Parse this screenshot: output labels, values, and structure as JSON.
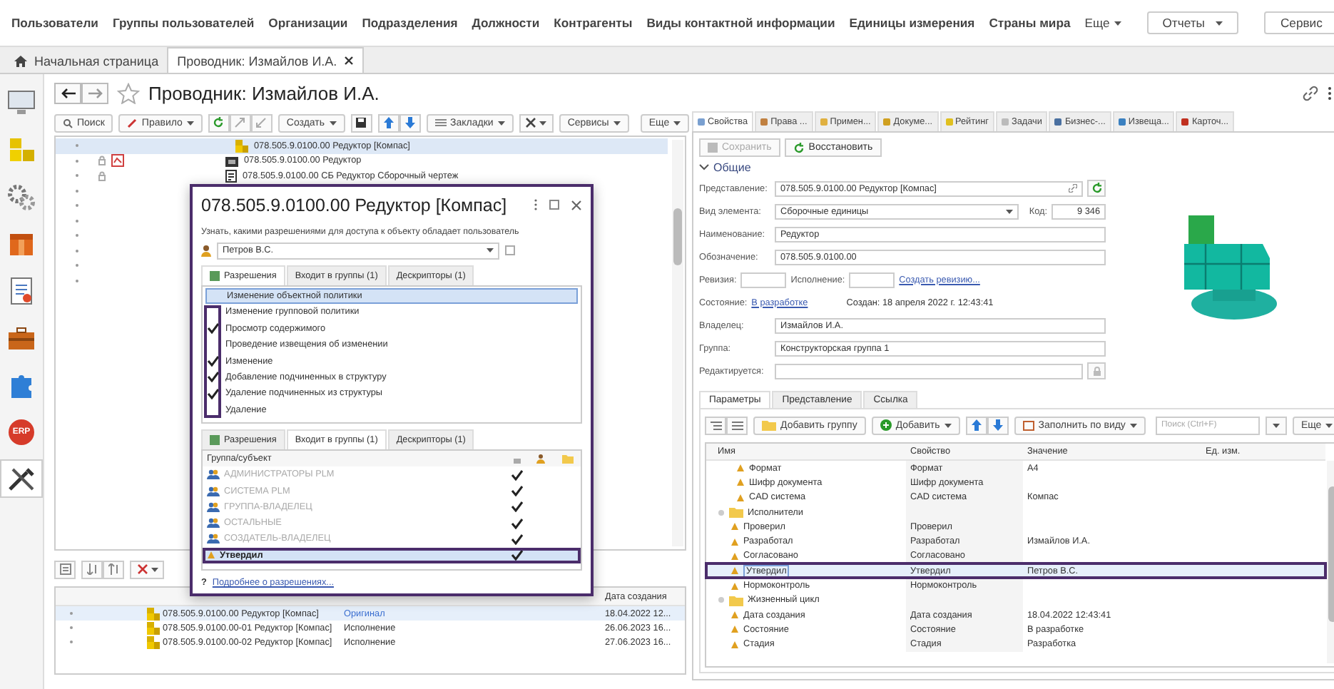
{
  "menu": {
    "items": [
      "Пользователи",
      "Группы пользователей",
      "Организации",
      "Подразделения",
      "Должности",
      "Контрагенты",
      "Виды контактной информации",
      "Единицы измерения",
      "Страны мира"
    ],
    "more": "Еще",
    "buttons": [
      "Отчеты",
      "Сервис"
    ]
  },
  "tabs": [
    {
      "label": "Начальная страница",
      "selected": false,
      "kind": "home"
    },
    {
      "label": "Проводник: Измайлов И.А.",
      "selected": true,
      "kind": "page"
    }
  ],
  "sidebar": [
    {
      "kind": "monitor",
      "selected": false
    },
    {
      "kind": "blocks",
      "selected": false
    },
    {
      "kind": "gears",
      "selected": false
    },
    {
      "kind": "box",
      "selected": false
    },
    {
      "kind": "document",
      "selected": false
    },
    {
      "kind": "briefcase",
      "selected": false
    },
    {
      "kind": "puzzle",
      "selected": false
    },
    {
      "kind": "badge",
      "label": "ERP",
      "selected": false
    },
    {
      "kind": "tools",
      "selected": true
    }
  ],
  "page": {
    "title": "Проводник: Измайлов И.А."
  },
  "left_toolbar": {
    "buttons": [
      {
        "label": "Поиск",
        "dropdown": false
      },
      {
        "label": "Правило",
        "dropdown": true
      },
      {
        "label": "Создать",
        "dropdown": true
      },
      {
        "label": "Закладки",
        "dropdown": true
      },
      {
        "label": "Сервисы",
        "dropdown": true
      },
      {
        "label": "Еще",
        "dropdown": true
      }
    ]
  },
  "tree": {
    "rows": [
      {
        "text": "078.505.9.0100.00 Редуктор [Компас]",
        "kind": "assembly",
        "selected": true,
        "children": [
          {
            "text": "078.505.9.0100.00 Редуктор",
            "kind": "model",
            "selected": false
          },
          {
            "text": "078.505.9.0100.00 СБ Редуктор Сборочный чертеж",
            "kind": "drawing",
            "selected": false
          }
        ]
      }
    ]
  },
  "versions": {
    "columns": [
      "Дата создания"
    ],
    "rows": [
      {
        "name": "078.505.9.0100.00 Редуктор [Компас]",
        "decision": "Оригинал",
        "date": "18.04.2022 12...",
        "selected": true
      },
      {
        "name": "078.505.9.0100.00-01 Редуктор [Компас]",
        "decision": "Исполнение",
        "date": "26.06.2023 16...",
        "selected": false
      },
      {
        "name": "078.505.9.0100.00-02 Редуктор [Компас]",
        "decision": "Исполнение",
        "date": "27.06.2023 16...",
        "selected": false
      }
    ]
  },
  "dialog": {
    "title": "078.505.9.0100.00 Редуктор [Компас]",
    "hint": "Узнать, какими разрешениями для доступа к объекту обладает пользователь",
    "user": "Петров В.С.",
    "tabs_top": [
      {
        "label": "Разрешения",
        "selected": true
      },
      {
        "label": "Входит в группы (1)",
        "selected": false
      },
      {
        "label": "Дескрипторы (1)",
        "selected": false
      }
    ],
    "permissions": [
      {
        "label": "Изменение объектной политики",
        "checked": false,
        "selected": true
      },
      {
        "label": "Изменение групповой политики",
        "checked": false,
        "selected": false
      },
      {
        "label": "Просмотр содержимого",
        "checked": true,
        "selected": false
      },
      {
        "label": "Проведение извещения об изменении",
        "checked": false,
        "selected": false
      },
      {
        "label": "Изменение",
        "checked": true,
        "selected": false
      },
      {
        "label": "Добавление подчиненных в структуру",
        "checked": true,
        "selected": false
      },
      {
        "label": "Удаление подчиненных из структуры",
        "checked": true,
        "selected": false
      },
      {
        "label": "Удаление",
        "checked": false,
        "selected": false
      }
    ],
    "tabs_bottom": [
      {
        "label": "Разрешения",
        "selected": false
      },
      {
        "label": "Входит в группы (1)",
        "selected": true
      },
      {
        "label": "Дескрипторы (1)",
        "selected": false
      }
    ],
    "groups_columns": [
      "Группа/субъект"
    ],
    "groups": [
      {
        "name": "АДМИНИСТРАТОРЫ PLM",
        "kind": "group",
        "checked": true,
        "selected": false
      },
      {
        "name": "СИСТЕМА PLM",
        "kind": "group",
        "checked": true,
        "selected": false
      },
      {
        "name": "ГРУППА-ВЛАДЕЛЕЦ",
        "kind": "group",
        "checked": true,
        "selected": false
      },
      {
        "name": "ОСТАЛЬНЫЕ",
        "kind": "group",
        "checked": true,
        "selected": false
      },
      {
        "name": "СОЗДАТЕЛЬ-ВЛАДЕЛЕЦ",
        "kind": "group",
        "checked": true,
        "selected": false
      },
      {
        "name": "Утвердил",
        "kind": "role",
        "checked": true,
        "selected": true
      }
    ],
    "help_mark": "?",
    "link": "Подробнее о разрешениях..."
  },
  "properties": {
    "tabs": [
      {
        "label": "Свойства",
        "selected": true
      },
      {
        "label": "Права ...",
        "selected": false
      },
      {
        "label": "Примен...",
        "selected": false
      },
      {
        "label": "Докуме...",
        "selected": false
      },
      {
        "label": "Рейтинг",
        "selected": false
      },
      {
        "label": "Задачи",
        "selected": false
      },
      {
        "label": "Бизнес-...",
        "selected": false
      },
      {
        "label": "Извеща...",
        "selected": false
      },
      {
        "label": "Карточ...",
        "selected": false
      }
    ],
    "actions": [
      {
        "label": "Сохранить",
        "disabled": true
      },
      {
        "label": "Восстановить",
        "disabled": false
      }
    ],
    "section": {
      "title": "Общие",
      "expanded": true
    },
    "representation": {
      "label": "Представление:",
      "value": "078.505.9.0100.00 Редуктор [Компас]"
    },
    "element_kind": {
      "label": "Вид элемента:",
      "value": "Сборочные единицы"
    },
    "code": {
      "label": "Код:",
      "value": "9 346"
    },
    "name": {
      "label": "Наименование:",
      "value": "Редуктор"
    },
    "designation": {
      "label": "Обозначение:",
      "value": "078.505.9.0100.00"
    },
    "revision": {
      "label": "Ревизия:"
    },
    "execution": {
      "label": "Исполнение:"
    },
    "create_revision": "Создать ревизию...",
    "state": {
      "label": "Состояние:",
      "value": "В разработке"
    },
    "created": "Создан: 18 апреля 2022 г. 12:43:41",
    "owner": {
      "label": "Владелец:",
      "value": "Измайлов И.А."
    },
    "group": {
      "label": "Группа:",
      "value": "Конструкторская группа 1"
    },
    "editing": {
      "label": "Редактируется:"
    }
  },
  "params": {
    "tabs": [
      {
        "label": "Параметры",
        "selected": true
      },
      {
        "label": "Представление",
        "selected": false
      },
      {
        "label": "Ссылка",
        "selected": false
      }
    ],
    "toolbar": {
      "buttons": [
        {
          "label": "Добавить группу",
          "dropdown": false
        },
        {
          "label": "Добавить",
          "dropdown": true
        },
        {
          "label": "Заполнить по виду",
          "dropdown": true
        }
      ],
      "search_placeholder": "Поиск (Ctrl+F)",
      "more": "Еще"
    },
    "columns": [
      "Имя",
      "Свойство",
      "Значение",
      "Ед. изм."
    ],
    "rows": [
      {
        "kind": "param",
        "name": "Формат",
        "property": "Формат",
        "value": "А4",
        "selected": false
      },
      {
        "kind": "param",
        "name": "Шифр документа",
        "property": "Шифр документа",
        "selected": false
      },
      {
        "kind": "param",
        "name": "CAD система",
        "property": "CAD система",
        "value": "Компас",
        "selected": false
      },
      {
        "kind": "group",
        "name": "Исполнители",
        "expanded": true,
        "selected": false,
        "children": [
          {
            "kind": "param",
            "name": "Проверил",
            "property": "Проверил",
            "selected": false
          },
          {
            "kind": "param",
            "name": "Разработал",
            "property": "Разработал",
            "value": "Измайлов И.А.",
            "selected": false
          },
          {
            "kind": "param",
            "name": "Согласовано",
            "property": "Согласовано",
            "selected": false
          },
          {
            "kind": "param",
            "name": "Утвердил",
            "property": "Утвердил",
            "value": "Петров В.С.",
            "selected": true
          },
          {
            "kind": "param",
            "name": "Нормоконтроль",
            "property": "Нормоконтроль",
            "selected": false
          }
        ]
      },
      {
        "kind": "group",
        "name": "Жизненный цикл",
        "expanded": true,
        "selected": false,
        "children": [
          {
            "kind": "param",
            "name": "Дата создания",
            "property": "Дата создания",
            "value": "18.04.2022 12:43:41",
            "selected": false
          },
          {
            "kind": "param",
            "name": "Состояние",
            "property": "Состояние",
            "value": "В разработке",
            "selected": false
          },
          {
            "kind": "param",
            "name": "Стадия",
            "property": "Стадия",
            "value": "Разработка",
            "selected": false
          }
        ]
      }
    ]
  }
}
